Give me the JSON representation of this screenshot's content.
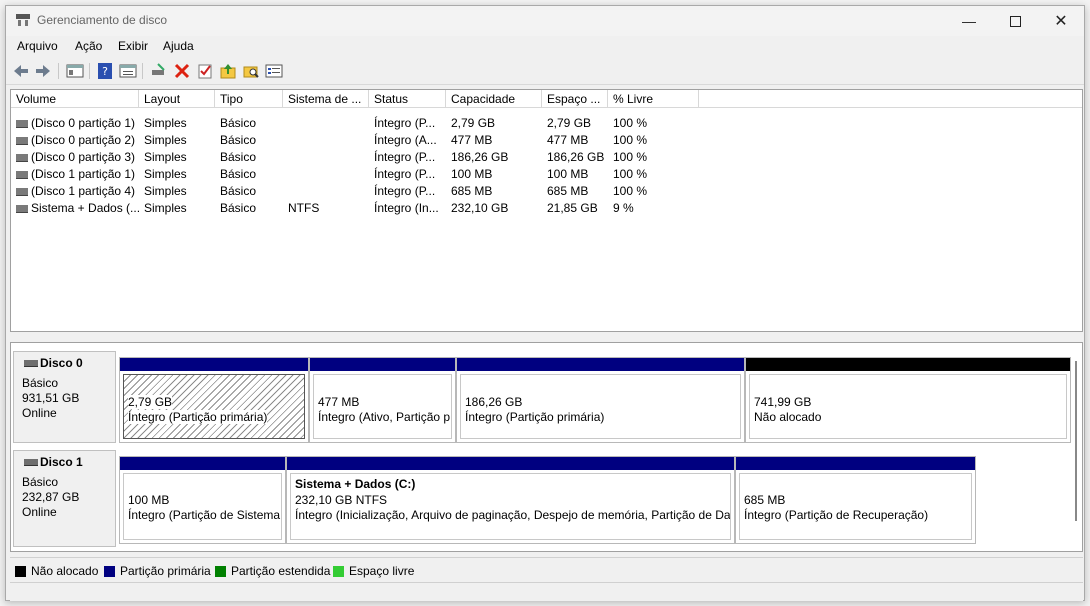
{
  "window": {
    "title": "Gerenciamento de disco"
  },
  "menu": [
    "Arquivo",
    "Ação",
    "Exibir",
    "Ajuda"
  ],
  "toolbar": {
    "icons": [
      "back-icon",
      "forward-icon",
      "console-tree-icon",
      "help-icon",
      "properties-icon",
      "connect-icon",
      "delete-icon",
      "check-icon",
      "folder-up-icon",
      "search-folder-icon",
      "settings-list-icon"
    ]
  },
  "volume_list": {
    "headers": [
      "Volume",
      "Layout",
      "Tipo",
      "Sistema de ...",
      "Status",
      "Capacidade",
      "Espaço ...",
      "% Livre"
    ],
    "rows": [
      [
        "(Disco 0 partição 1)",
        "Simples",
        "Básico",
        "",
        "Íntegro (P...",
        "2,79 GB",
        "2,79 GB",
        "100 %"
      ],
      [
        "(Disco 0 partição 2)",
        "Simples",
        "Básico",
        "",
        "Íntegro (A...",
        "477 MB",
        "477 MB",
        "100 %"
      ],
      [
        "(Disco 0 partição 3)",
        "Simples",
        "Básico",
        "",
        "Íntegro (P...",
        "186,26 GB",
        "186,26 GB",
        "100 %"
      ],
      [
        "(Disco 1 partição 1)",
        "Simples",
        "Básico",
        "",
        "Íntegro (P...",
        "100 MB",
        "100 MB",
        "100 %"
      ],
      [
        "(Disco 1 partição 4)",
        "Simples",
        "Básico",
        "",
        "Íntegro (P...",
        "685 MB",
        "685 MB",
        "100 %"
      ],
      [
        "Sistema + Dados (...",
        "Simples",
        "Básico",
        "NTFS",
        "Íntegro (In...",
        "232,10 GB",
        "21,85 GB",
        "9 %"
      ]
    ]
  },
  "disks": [
    {
      "name": "Disco 0",
      "type": "Básico",
      "size": "931,51 GB",
      "state": "Online",
      "partitions": [
        {
          "l1": "2,79 GB",
          "l2": "Íntegro (Partição primária)",
          "l3": ""
        },
        {
          "l1": "477 MB",
          "l2": "Íntegro (Ativo, Partição p",
          "l3": ""
        },
        {
          "l1": "186,26 GB",
          "l2": "Íntegro (Partição primária)",
          "l3": ""
        },
        {
          "l1": "741,99 GB",
          "l2": "Não alocado",
          "l3": ""
        }
      ]
    },
    {
      "name": "Disco 1",
      "type": "Básico",
      "size": "232,87 GB",
      "state": "Online",
      "partitions": [
        {
          "l1": "100 MB",
          "l2": "Íntegro (Partição de Sistema",
          "l3": ""
        },
        {
          "l1": "Sistema + Dados  (C:)",
          "l2": "232,10 GB NTFS",
          "l3": "Íntegro (Inicialização, Arquivo de paginação, Despejo de memória, Partição de Dac"
        },
        {
          "l1": "685 MB",
          "l2": "Íntegro (Partição de Recuperação)",
          "l3": ""
        }
      ]
    }
  ],
  "legend": [
    {
      "label": "Não alocado",
      "color": "#000000"
    },
    {
      "label": "Partição primária",
      "color": "#000080"
    },
    {
      "label": "Partição estendida",
      "color": "#008000"
    },
    {
      "label": "Espaço livre",
      "color": "#33cc33"
    }
  ],
  "colors": {
    "primary_bar": "#000080",
    "unallocated_bar": "#000000"
  }
}
